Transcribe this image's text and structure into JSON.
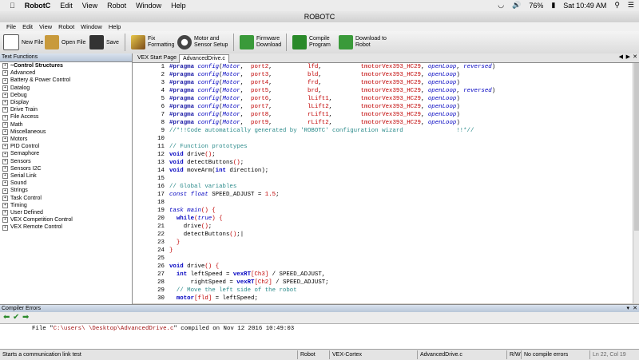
{
  "mac_menubar": {
    "app_name": "RobotC",
    "items": [
      "Edit",
      "View",
      "Robot",
      "Window",
      "Help"
    ],
    "battery": "76%",
    "datetime": "Sat 10:49 AM"
  },
  "window": {
    "title": "ROBOTC"
  },
  "app_menu": [
    "File",
    "Edit",
    "View",
    "Robot",
    "Window",
    "Help"
  ],
  "toolbar": {
    "new_file": "New File",
    "open_file": "Open File",
    "save": "Save",
    "fix_formatting_1": "Fix",
    "fix_formatting_2": "Formatting",
    "motor_setup_1": "Motor and",
    "motor_setup_2": "Sensor Setup",
    "firmware_1": "Firmware",
    "firmware_2": "Download",
    "compile_1": "Compile",
    "compile_2": "Program",
    "download_1": "Download to",
    "download_2": "Robot"
  },
  "left_panel": {
    "title": "Text Functions",
    "items": [
      "~Control Structures",
      "Advanced",
      "Battery & Power Control",
      "Datalog",
      "Debug",
      "Display",
      "Drive Train",
      "File Access",
      "Math",
      "Miscellaneous",
      "Motors",
      "PID Control",
      "Semaphore",
      "Sensors",
      "Sensors I2C",
      "Serial Link",
      "Sound",
      "Strings",
      "Task Control",
      "Timing",
      "User Defined",
      "VEX Competition Control",
      "VEX Remote Control"
    ]
  },
  "editor": {
    "tabs": [
      "VEX Start Page",
      "AdvancedDrive.c"
    ],
    "lines": [
      {
        "n": "1",
        "segs": [
          [
            "pp",
            "#pragma "
          ],
          [
            "it",
            "config"
          ],
          [
            "fn",
            "("
          ],
          [
            "it",
            "Motor"
          ],
          [
            "fn",
            ",  "
          ],
          [
            "red",
            "port2"
          ],
          [
            "fn",
            ",          "
          ],
          [
            "red",
            "lfd"
          ],
          [
            "fn",
            ",           "
          ],
          [
            "red",
            "tmotorVex393_HC29"
          ],
          [
            "fn",
            ", "
          ],
          [
            "it",
            "openLoop"
          ],
          [
            "fn",
            ", "
          ],
          [
            "it",
            "reversed"
          ],
          [
            "fn",
            ")"
          ]
        ]
      },
      {
        "n": "2",
        "segs": [
          [
            "pp",
            "#pragma "
          ],
          [
            "it",
            "config"
          ],
          [
            "fn",
            "("
          ],
          [
            "it",
            "Motor"
          ],
          [
            "fn",
            ",  "
          ],
          [
            "red",
            "port3"
          ],
          [
            "fn",
            ",          "
          ],
          [
            "red",
            "bld"
          ],
          [
            "fn",
            ",           "
          ],
          [
            "red",
            "tmotorVex393_HC29"
          ],
          [
            "fn",
            ", "
          ],
          [
            "it",
            "openLoop"
          ],
          [
            "fn",
            ")"
          ]
        ]
      },
      {
        "n": "3",
        "segs": [
          [
            "pp",
            "#pragma "
          ],
          [
            "it",
            "config"
          ],
          [
            "fn",
            "("
          ],
          [
            "it",
            "Motor"
          ],
          [
            "fn",
            ",  "
          ],
          [
            "red",
            "port4"
          ],
          [
            "fn",
            ",          "
          ],
          [
            "red",
            "frd"
          ],
          [
            "fn",
            ",           "
          ],
          [
            "red",
            "tmotorVex393_HC29"
          ],
          [
            "fn",
            ", "
          ],
          [
            "it",
            "openLoop"
          ],
          [
            "fn",
            ")"
          ]
        ]
      },
      {
        "n": "4",
        "segs": [
          [
            "pp",
            "#pragma "
          ],
          [
            "it",
            "config"
          ],
          [
            "fn",
            "("
          ],
          [
            "it",
            "Motor"
          ],
          [
            "fn",
            ",  "
          ],
          [
            "red",
            "port5"
          ],
          [
            "fn",
            ",          "
          ],
          [
            "red",
            "brd"
          ],
          [
            "fn",
            ",           "
          ],
          [
            "red",
            "tmotorVex393_HC29"
          ],
          [
            "fn",
            ", "
          ],
          [
            "it",
            "openLoop"
          ],
          [
            "fn",
            ", "
          ],
          [
            "it",
            "reversed"
          ],
          [
            "fn",
            ")"
          ]
        ]
      },
      {
        "n": "5",
        "segs": [
          [
            "pp",
            "#pragma "
          ],
          [
            "it",
            "config"
          ],
          [
            "fn",
            "("
          ],
          [
            "it",
            "Motor"
          ],
          [
            "fn",
            ",  "
          ],
          [
            "red",
            "port6"
          ],
          [
            "fn",
            ",          "
          ],
          [
            "red",
            "lLift1"
          ],
          [
            "fn",
            ",        "
          ],
          [
            "red",
            "tmotorVex393_HC29"
          ],
          [
            "fn",
            ", "
          ],
          [
            "it",
            "openLoop"
          ],
          [
            "fn",
            ")"
          ]
        ]
      },
      {
        "n": "6",
        "segs": [
          [
            "pp",
            "#pragma "
          ],
          [
            "it",
            "config"
          ],
          [
            "fn",
            "("
          ],
          [
            "it",
            "Motor"
          ],
          [
            "fn",
            ",  "
          ],
          [
            "red",
            "port7"
          ],
          [
            "fn",
            ",          "
          ],
          [
            "red",
            "lLift2"
          ],
          [
            "fn",
            ",        "
          ],
          [
            "red",
            "tmotorVex393_HC29"
          ],
          [
            "fn",
            ", "
          ],
          [
            "it",
            "openLoop"
          ],
          [
            "fn",
            ")"
          ]
        ]
      },
      {
        "n": "7",
        "segs": [
          [
            "pp",
            "#pragma "
          ],
          [
            "it",
            "config"
          ],
          [
            "fn",
            "("
          ],
          [
            "it",
            "Motor"
          ],
          [
            "fn",
            ",  "
          ],
          [
            "red",
            "port8"
          ],
          [
            "fn",
            ",          "
          ],
          [
            "red",
            "rLift1"
          ],
          [
            "fn",
            ",        "
          ],
          [
            "red",
            "tmotorVex393_HC29"
          ],
          [
            "fn",
            ", "
          ],
          [
            "it",
            "openLoop"
          ],
          [
            "fn",
            ")"
          ]
        ]
      },
      {
        "n": "8",
        "segs": [
          [
            "pp",
            "#pragma "
          ],
          [
            "it",
            "config"
          ],
          [
            "fn",
            "("
          ],
          [
            "it",
            "Motor"
          ],
          [
            "fn",
            ",  "
          ],
          [
            "red",
            "port9"
          ],
          [
            "fn",
            ",          "
          ],
          [
            "red",
            "rLift2"
          ],
          [
            "fn",
            ",        "
          ],
          [
            "red",
            "tmotorVex393_HC29"
          ],
          [
            "fn",
            ", "
          ],
          [
            "it",
            "openLoop"
          ],
          [
            "fn",
            ")"
          ]
        ]
      },
      {
        "n": "9",
        "segs": [
          [
            "cm",
            "//*!!Code automatically generated by 'ROBOTC' configuration wizard               !!*//"
          ]
        ]
      },
      {
        "n": "10",
        "segs": []
      },
      {
        "n": "11",
        "segs": [
          [
            "cm",
            "// Function prototypes"
          ]
        ]
      },
      {
        "n": "12",
        "segs": [
          [
            "kw",
            "void"
          ],
          [
            "fn",
            " drive"
          ],
          [
            "red",
            "()"
          ],
          [
            "fn",
            ";"
          ]
        ]
      },
      {
        "n": "13",
        "segs": [
          [
            "kw",
            "void"
          ],
          [
            "fn",
            " detectButtons"
          ],
          [
            "red",
            "()"
          ],
          [
            "fn",
            ";"
          ]
        ]
      },
      {
        "n": "14",
        "segs": [
          [
            "kw",
            "void"
          ],
          [
            "fn",
            " moveArm("
          ],
          [
            "kw",
            "int"
          ],
          [
            "fn",
            " direction);"
          ]
        ]
      },
      {
        "n": "15",
        "segs": []
      },
      {
        "n": "16",
        "segs": [
          [
            "cm",
            "// Global variables"
          ]
        ]
      },
      {
        "n": "17",
        "segs": [
          [
            "it",
            "const float"
          ],
          [
            "fn",
            " SPEED_ADJUST = "
          ],
          [
            "red",
            "1.5"
          ],
          [
            "fn",
            ";"
          ]
        ]
      },
      {
        "n": "18",
        "segs": []
      },
      {
        "n": "19",
        "segs": [
          [
            "it",
            "task main"
          ],
          [
            "red",
            "()"
          ],
          [
            "fn",
            " "
          ],
          [
            "red",
            "{"
          ]
        ]
      },
      {
        "n": "20",
        "segs": [
          [
            "fn",
            "  "
          ],
          [
            "kw",
            "while"
          ],
          [
            "red",
            "("
          ],
          [
            "it",
            "true"
          ],
          [
            "red",
            ")"
          ],
          [
            "fn",
            " "
          ],
          [
            "red",
            "{"
          ]
        ]
      },
      {
        "n": "21",
        "segs": [
          [
            "fn",
            "    drive"
          ],
          [
            "red",
            "()"
          ],
          [
            "fn",
            ";"
          ]
        ]
      },
      {
        "n": "22",
        "segs": [
          [
            "fn",
            "    detectButtons"
          ],
          [
            "red",
            "()"
          ],
          [
            "fn",
            ";|"
          ]
        ]
      },
      {
        "n": "23",
        "segs": [
          [
            "red",
            "  }"
          ]
        ]
      },
      {
        "n": "24",
        "segs": [
          [
            "red",
            "}"
          ]
        ]
      },
      {
        "n": "25",
        "segs": []
      },
      {
        "n": "26",
        "segs": [
          [
            "kw",
            "void"
          ],
          [
            "fn",
            " drive"
          ],
          [
            "red",
            "()"
          ],
          [
            "fn",
            " "
          ],
          [
            "red",
            "{"
          ]
        ]
      },
      {
        "n": "27",
        "segs": [
          [
            "fn",
            "  "
          ],
          [
            "kw",
            "int"
          ],
          [
            "fn",
            " leftSpeed = "
          ],
          [
            "kw",
            "vexRT"
          ],
          [
            "red",
            "[Ch3]"
          ],
          [
            "fn",
            " / SPEED_ADJUST,"
          ]
        ]
      },
      {
        "n": "28",
        "segs": [
          [
            "fn",
            "      rightSpeed = "
          ],
          [
            "kw",
            "vexRT"
          ],
          [
            "red",
            "[Ch2]"
          ],
          [
            "fn",
            " / SPEED_ADJUST;"
          ]
        ]
      },
      {
        "n": "29",
        "segs": [
          [
            "cm",
            "  // Move the left side of the robot"
          ]
        ]
      },
      {
        "n": "30",
        "segs": [
          [
            "fn",
            "  "
          ],
          [
            "kw",
            "motor"
          ],
          [
            "red",
            "[fld]"
          ],
          [
            "fn",
            " = leftSpeed;"
          ]
        ]
      }
    ]
  },
  "compiler": {
    "title": "Compiler Errors",
    "msg_prefix": "File \"",
    "msg_path": "C:\\users\\        \\Desktop\\AdvancedDrive.c",
    "msg_suffix": "\" compiled on Nov 12 2016 10:49:03"
  },
  "status": {
    "message": "Starts a communication link test",
    "robot": "Robot",
    "platform": "VEX-Cortex",
    "file": "AdvancedDrive.c",
    "mode": "R/W",
    "errors": "No compile errors",
    "position": "Ln 22, Col 19"
  }
}
